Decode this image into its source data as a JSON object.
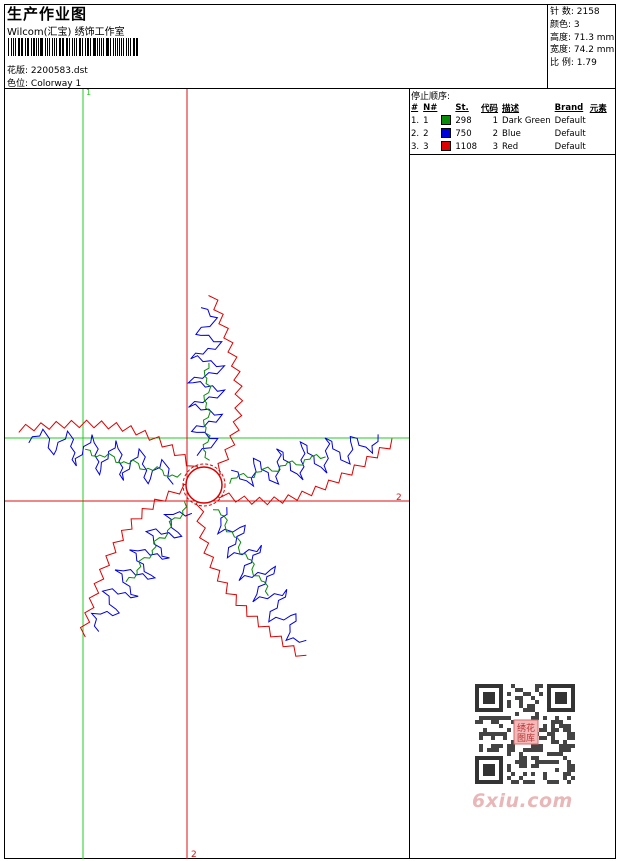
{
  "header": {
    "title": "生产作业图",
    "studio": "Wilcom(汇宝) 绣饰工作室",
    "design_label": "花版:",
    "design_value": "2200583.dst",
    "colorway_label": "色位:",
    "colorway_value": "Colorway 1"
  },
  "stats": {
    "stitches": "针 数: 2158",
    "colors": "颜色: 3",
    "height": "高度: 71.3 mm",
    "width": "宽度: 74.2 mm",
    "ratio": "比 例: 1.79"
  },
  "stop_sequence": {
    "title": "停止顺序:",
    "headers": [
      "#",
      "N#",
      "St.",
      "代码",
      "描述",
      "Brand",
      "元素"
    ],
    "rows": [
      {
        "idx": "1.",
        "n": "1",
        "color": "#0a8a0a",
        "st": "298",
        "code": "1",
        "desc": "Dark Green",
        "brand": "Default"
      },
      {
        "idx": "2.",
        "n": "2",
        "color": "#0000dd",
        "st": "750",
        "code": "2",
        "desc": "Blue",
        "brand": "Default"
      },
      {
        "idx": "3.",
        "n": "3",
        "color": "#dd0000",
        "st": "1108",
        "code": "3",
        "desc": "Red",
        "brand": "Default"
      }
    ]
  },
  "guides": {
    "green_label": "1",
    "red_h_label": "2",
    "red_v_label": "2"
  },
  "colors": {
    "thread_green": "#0a8a0a",
    "thread_blue": "#0000dd",
    "thread_red": "#dd0000",
    "guide_green": "#22cc22",
    "guide_red": "#dd1111"
  },
  "watermark": {
    "site": "6xiu.com",
    "qr_stamp": "绣花图库"
  }
}
